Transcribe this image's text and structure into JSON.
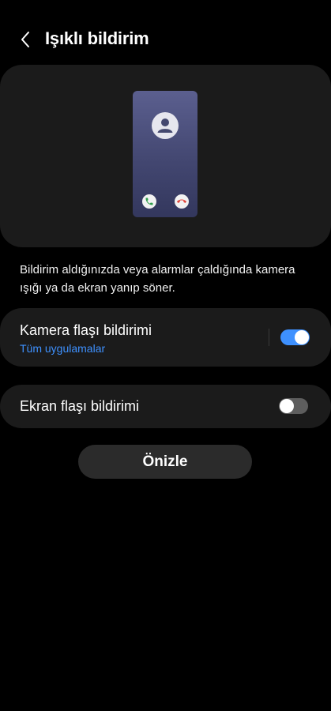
{
  "header": {
    "title": "Işıklı bildirim",
    "back_icon": "chevron-left-icon"
  },
  "description": "Bildirim aldığınızda veya alarmlar çaldığında kamera ışığı ya da ekran yanıp söner.",
  "settings": [
    {
      "title": "Kamera flaşı bildirimi",
      "subtitle": "Tüm uygulamalar",
      "enabled": true
    },
    {
      "title": "Ekran flaşı bildirimi",
      "enabled": false
    }
  ],
  "preview_button_label": "Önizle",
  "colors": {
    "background": "#000000",
    "card": "#1b1b1b",
    "accent": "#3e91ff",
    "toggle_off": "#5e5e5e",
    "accept": "#2e9d4a",
    "decline": "#e2453c"
  }
}
